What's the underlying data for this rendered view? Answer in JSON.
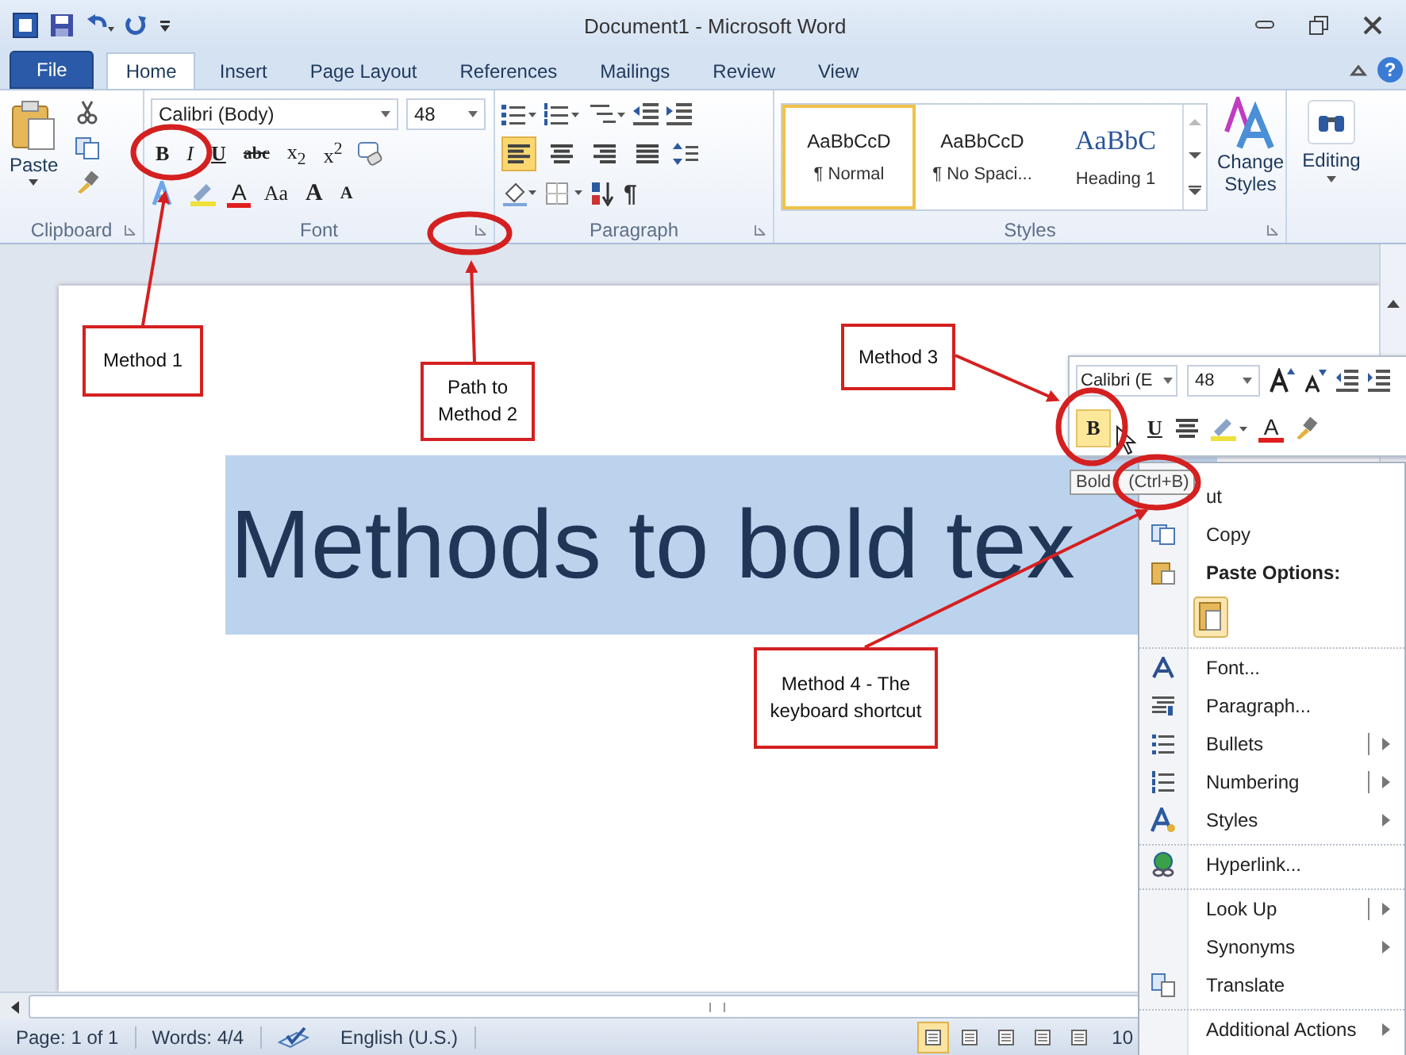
{
  "window": {
    "title": "Document1 - Microsoft Word"
  },
  "tabs": [
    {
      "label": "File",
      "kind": "file",
      "selected": false
    },
    {
      "label": "Home",
      "kind": "tab",
      "selected": true
    },
    {
      "label": "Insert",
      "kind": "tab",
      "selected": false
    },
    {
      "label": "Page Layout",
      "kind": "tab",
      "selected": false
    },
    {
      "label": "References",
      "kind": "tab",
      "selected": false
    },
    {
      "label": "Mailings",
      "kind": "tab",
      "selected": false
    },
    {
      "label": "Review",
      "kind": "tab",
      "selected": false
    },
    {
      "label": "View",
      "kind": "tab",
      "selected": false
    }
  ],
  "help": "?",
  "clipboard": {
    "label": "Clipboard",
    "paste": "Paste"
  },
  "font": {
    "label": "Font",
    "name": "Calibri (Body)",
    "size": "48",
    "row2": [
      {
        "text": "B",
        "kind": "bold"
      },
      {
        "text": "I",
        "kind": "italic"
      },
      {
        "text": "U",
        "kind": "underline"
      },
      {
        "text": "abc",
        "kind": "strike"
      },
      {
        "text": "x$_{2}$",
        "kind": "script"
      },
      {
        "text": "x$^{2}$",
        "kind": "script"
      }
    ],
    "row3": [
      {
        "text": "A",
        "kind": "color"
      },
      {
        "text": "Aa",
        "kind": "case"
      },
      {
        "text": "A",
        "kind": "grow"
      },
      {
        "text": "A",
        "kind": "shrink"
      }
    ]
  },
  "paragraph": {
    "label": "Paragraph",
    "pilcrow": "¶",
    "alignments": [
      {
        "selected": true
      },
      {
        "selected": false
      },
      {
        "selected": false
      },
      {
        "selected": false
      }
    ]
  },
  "styles": {
    "label": "Styles",
    "items": [
      {
        "preview": "AaBbCcD",
        "name": "¶ Normal",
        "kind": "body",
        "selected": true
      },
      {
        "preview": "AaBbCcD",
        "name": "¶ No Spaci...",
        "kind": "body",
        "selected": false
      },
      {
        "preview": "AaBbC",
        "name": "Heading 1",
        "kind": "heading",
        "selected": false
      }
    ],
    "change": "Change Styles"
  },
  "editing": {
    "label": "Editing"
  },
  "document": {
    "text": "Methods to bold tex",
    "highlighted": true
  },
  "callouts": [
    "Method 1",
    "Path to Method 2",
    "Method 3",
    "Method 4 - The keyboard shortcut"
  ],
  "mini_toolbar": {
    "font": "Calibri (E",
    "size": "48",
    "bold": {
      "text": "B",
      "hovered": true
    },
    "underline": "U",
    "font_color_letter": "A"
  },
  "tooltip": "Bold (Ctrl+B)",
  "context_menu": [
    {
      "label": "ut",
      "kind": "item",
      "submenu": false,
      "split": false,
      "separator": false
    },
    {
      "label": "Copy",
      "kind": "item",
      "submenu": false,
      "split": false,
      "separator": false
    },
    {
      "label": "Paste Options:",
      "kind": "header",
      "submenu": false,
      "split": false,
      "separator": false
    },
    {
      "kind": "paste"
    },
    {
      "label": "Font...",
      "kind": "item",
      "submenu": false,
      "split": false,
      "separator": true
    },
    {
      "label": "Paragraph...",
      "kind": "item",
      "submenu": false,
      "split": false,
      "separator": false
    },
    {
      "label": "Bullets",
      "kind": "item",
      "submenu": true,
      "split": true,
      "separator": false
    },
    {
      "label": "Numbering",
      "kind": "item",
      "submenu": true,
      "split": true,
      "separator": false
    },
    {
      "label": "Styles",
      "kind": "item",
      "submenu": true,
      "split": false,
      "separator": false
    },
    {
      "label": "Hyperlink...",
      "kind": "item",
      "submenu": false,
      "split": false,
      "separator": true
    },
    {
      "label": "Look Up",
      "kind": "item",
      "submenu": true,
      "split": true,
      "separator": true
    },
    {
      "label": "Synonyms",
      "kind": "item",
      "submenu": true,
      "split": false,
      "separator": false
    },
    {
      "label": "Translate",
      "kind": "item",
      "submenu": false,
      "split": false,
      "separator": false
    },
    {
      "label": "Additional Actions",
      "kind": "item",
      "submenu": true,
      "split": false,
      "separator": true
    }
  ],
  "status_bar": {
    "page": "Page: 1 of 1",
    "words": "Words: 4/4",
    "language": "English (U.S.)",
    "views": [
      {
        "selected": true
      },
      {
        "selected": false
      },
      {
        "selected": false
      },
      {
        "selected": false
      },
      {
        "selected": false
      }
    ],
    "zoom": "10"
  }
}
